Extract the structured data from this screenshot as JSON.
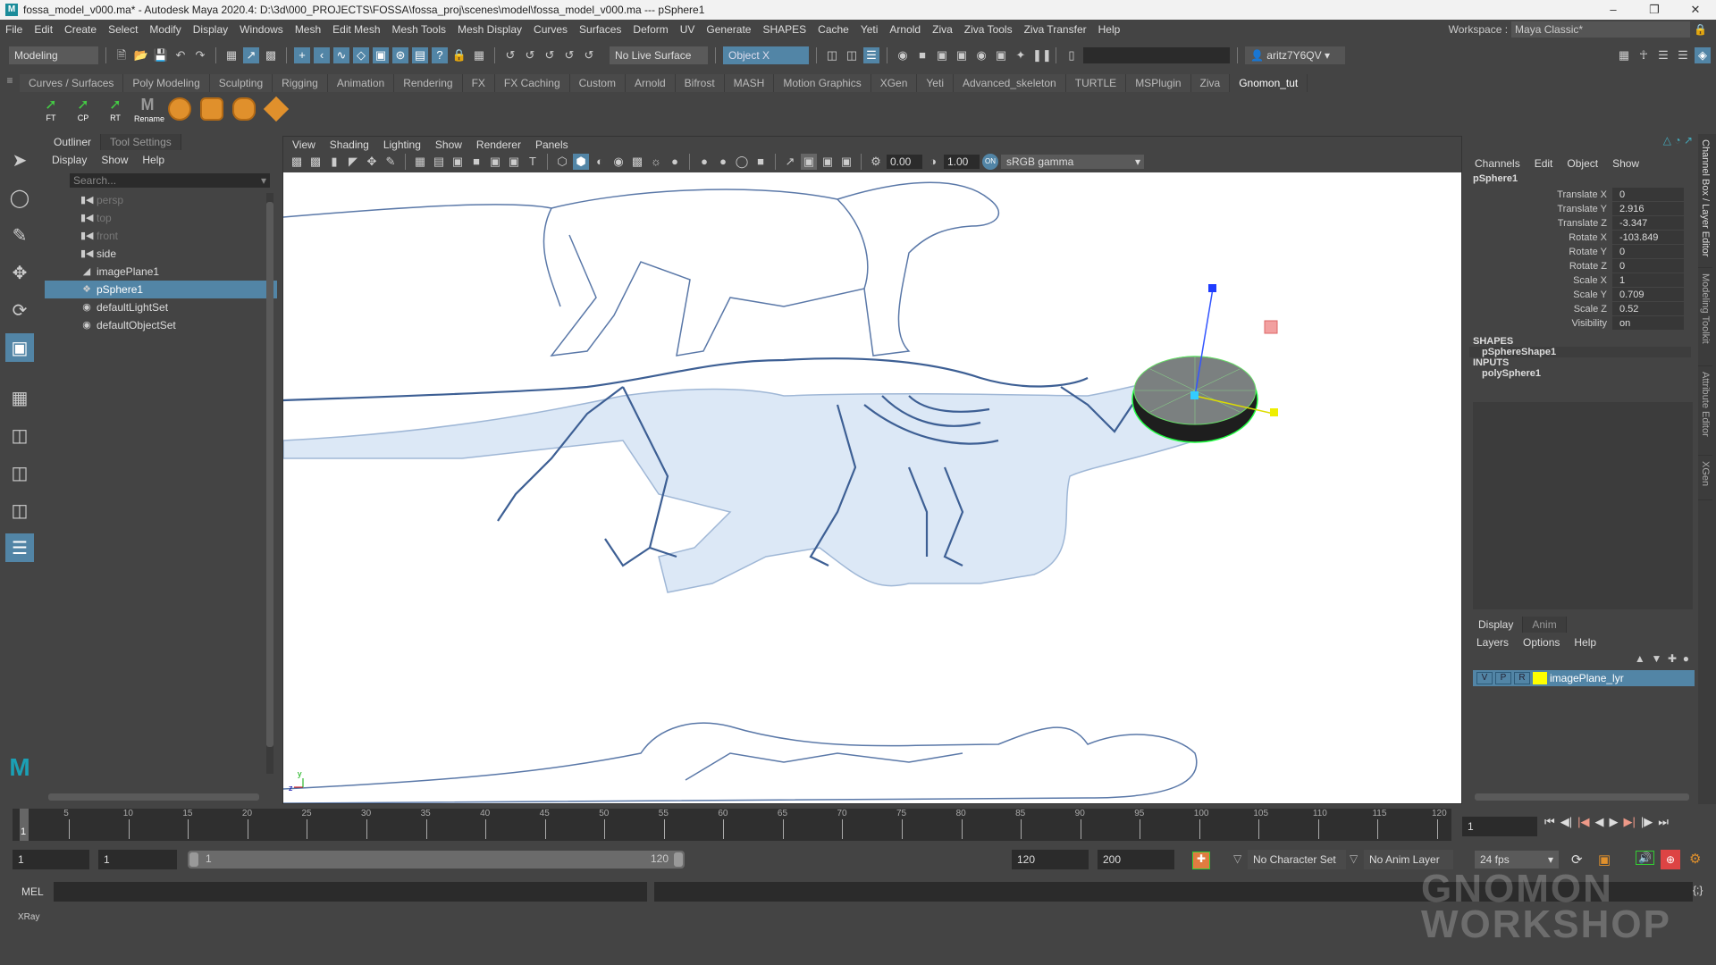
{
  "title": "fossa_model_v000.ma* - Autodesk Maya 2020.4: D:\\3d\\000_PROJECTS\\FOSSA\\fossa_proj\\scenes\\model\\fossa_model_v000.ma  ---  pSphere1",
  "menus": [
    "File",
    "Edit",
    "Create",
    "Select",
    "Modify",
    "Display",
    "Windows",
    "Mesh",
    "Edit Mesh",
    "Mesh Tools",
    "Mesh Display",
    "Curves",
    "Surfaces",
    "Deform",
    "UV",
    "Generate",
    "SHAPES",
    "Cache",
    "Yeti",
    "Arnold",
    "Ziva",
    "Ziva Tools",
    "Ziva Transfer",
    "Help"
  ],
  "workspace": {
    "label": "Workspace :",
    "value": "Maya Classic*"
  },
  "statusline": {
    "menuset": "Modeling",
    "live_surface": "No Live Surface",
    "symmetry": "Object X",
    "user": "aritz7Y6QV"
  },
  "shelf_tabs": [
    "Curves / Surfaces",
    "Poly Modeling",
    "Sculpting",
    "Rigging",
    "Animation",
    "Rendering",
    "FX",
    "FX Caching",
    "Custom",
    "Arnold",
    "Bifrost",
    "MASH",
    "Motion Graphics",
    "XGen",
    "Yeti",
    "Advanced_skeleton",
    "TURTLE",
    "MSPlugin",
    "Ziva",
    "Gnomon_tut"
  ],
  "shelf_active": "Gnomon_tut",
  "shelf_buttons": [
    "FT",
    "CP",
    "RT",
    "Rename"
  ],
  "outliner": {
    "tabs": [
      "Outliner",
      "Tool Settings"
    ],
    "menus": [
      "Display",
      "Show",
      "Help"
    ],
    "search_placeholder": "Search...",
    "items": [
      {
        "label": "persp",
        "icon": "camera-icon",
        "dim": true
      },
      {
        "label": "top",
        "icon": "camera-icon",
        "dim": true
      },
      {
        "label": "front",
        "icon": "camera-icon",
        "dim": true
      },
      {
        "label": "side",
        "icon": "camera-icon"
      },
      {
        "label": "imagePlane1",
        "icon": "image-plane-icon"
      },
      {
        "label": "pSphere1",
        "icon": "mesh-icon",
        "selected": true
      },
      {
        "label": "defaultLightSet",
        "icon": "set-icon"
      },
      {
        "label": "defaultObjectSet",
        "icon": "set-icon"
      }
    ]
  },
  "viewport": {
    "menus": [
      "View",
      "Shading",
      "Lighting",
      "Show",
      "Renderer",
      "Panels"
    ],
    "exposure": "0.00",
    "gamma": "1.00",
    "colorspace": "sRGB gamma"
  },
  "channelbox": {
    "menus": [
      "Channels",
      "Edit",
      "Object",
      "Show"
    ],
    "object": "pSphere1",
    "attrs": [
      {
        "label": "Translate X",
        "value": "0"
      },
      {
        "label": "Translate Y",
        "value": "2.916"
      },
      {
        "label": "Translate Z",
        "value": "-3.347"
      },
      {
        "label": "Rotate X",
        "value": "-103.849"
      },
      {
        "label": "Rotate Y",
        "value": "0"
      },
      {
        "label": "Rotate Z",
        "value": "0"
      },
      {
        "label": "Scale X",
        "value": "1"
      },
      {
        "label": "Scale Y",
        "value": "0.709"
      },
      {
        "label": "Scale Z",
        "value": "0.52"
      },
      {
        "label": "Visibility",
        "value": "on"
      }
    ],
    "shapes_label": "SHAPES",
    "shape": "pSphereShape1",
    "inputs_label": "INPUTS",
    "input": "polySphere1"
  },
  "side_tabs": [
    "Channel Box / Layer Editor",
    "Modeling Toolkit",
    "Attribute Editor",
    "XGen"
  ],
  "layers": {
    "tabs": [
      "Display",
      "Anim"
    ],
    "menus": [
      "Layers",
      "Options",
      "Help"
    ],
    "layer": {
      "v": "V",
      "p": "P",
      "r": "R",
      "name": "imagePlane_lyr",
      "color": "#ffff00"
    }
  },
  "timeline": {
    "ticks": [
      "5",
      "10",
      "15",
      "20",
      "25",
      "30",
      "35",
      "40",
      "45",
      "50",
      "55",
      "60",
      "65",
      "70",
      "75",
      "80",
      "85",
      "90",
      "95",
      "100",
      "105",
      "110",
      "115",
      "120"
    ],
    "current": "1",
    "current_field": "1"
  },
  "range": {
    "start": "1",
    "playback_start": "1",
    "slider_start": "1",
    "slider_end": "120",
    "playback_end": "120",
    "end": "200",
    "character_set": "No Character Set",
    "anim_layer": "No Anim Layer",
    "fps": "24 fps"
  },
  "mel": {
    "label": "MEL"
  },
  "helpline": "XRay",
  "watermark": "THE GNOMON WORKSHOP",
  "colors": {
    "accent": "#5285a6",
    "panel": "#444444",
    "selection": "#5285a6"
  }
}
